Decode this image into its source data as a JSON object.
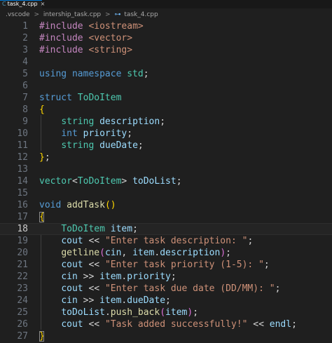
{
  "tab": {
    "icon": "C",
    "name": "task_4.cpp",
    "close": "×"
  },
  "breadcrumb": {
    "parts": [
      ".vscode",
      "intership_task.cpp",
      "task_4.cpp"
    ],
    "separator": ">",
    "symbol_icon": "⊶"
  },
  "editor": {
    "current_line": 18,
    "lines": [
      {
        "n": "1",
        "tokens": [
          [
            "pre",
            "#include "
          ],
          [
            "inc",
            "<iostream>"
          ]
        ]
      },
      {
        "n": "2",
        "tokens": [
          [
            "pre",
            "#include "
          ],
          [
            "inc",
            "<vector>"
          ]
        ]
      },
      {
        "n": "3",
        "tokens": [
          [
            "pre",
            "#include "
          ],
          [
            "inc",
            "<string>"
          ]
        ]
      },
      {
        "n": "4",
        "tokens": []
      },
      {
        "n": "5",
        "tokens": [
          [
            "kw",
            "using namespace "
          ],
          [
            "type",
            "std"
          ],
          [
            "text",
            ";"
          ]
        ]
      },
      {
        "n": "6",
        "tokens": []
      },
      {
        "n": "7",
        "tokens": [
          [
            "kw",
            "struct "
          ],
          [
            "type",
            "ToDoItem"
          ]
        ]
      },
      {
        "n": "8",
        "tokens": [
          [
            "br1",
            "{"
          ]
        ]
      },
      {
        "n": "9",
        "tokens": [
          [
            "text",
            "    "
          ],
          [
            "type",
            "string "
          ],
          [
            "var",
            "description"
          ],
          [
            "text",
            ";"
          ]
        ]
      },
      {
        "n": "10",
        "tokens": [
          [
            "text",
            "    "
          ],
          [
            "kw",
            "int "
          ],
          [
            "var",
            "priority"
          ],
          [
            "text",
            ";"
          ]
        ]
      },
      {
        "n": "11",
        "tokens": [
          [
            "text",
            "    "
          ],
          [
            "type",
            "string "
          ],
          [
            "var",
            "dueDate"
          ],
          [
            "text",
            ";"
          ]
        ]
      },
      {
        "n": "12",
        "tokens": [
          [
            "br1",
            "}"
          ],
          [
            "text",
            ";"
          ]
        ]
      },
      {
        "n": "13",
        "tokens": []
      },
      {
        "n": "14",
        "tokens": [
          [
            "type",
            "vector"
          ],
          [
            "text",
            "<"
          ],
          [
            "type",
            "ToDoItem"
          ],
          [
            "text",
            "> "
          ],
          [
            "var",
            "toDoList"
          ],
          [
            "text",
            ";"
          ]
        ]
      },
      {
        "n": "15",
        "tokens": []
      },
      {
        "n": "16",
        "tokens": [
          [
            "kw",
            "void "
          ],
          [
            "fn",
            "addTask"
          ],
          [
            "br1",
            "()"
          ]
        ]
      },
      {
        "n": "17",
        "tokens": [
          [
            "br1",
            "{"
          ]
        ]
      },
      {
        "n": "18",
        "tokens": [
          [
            "text",
            "    "
          ],
          [
            "type",
            "ToDoItem "
          ],
          [
            "var",
            "item"
          ],
          [
            "text",
            ";"
          ]
        ]
      },
      {
        "n": "19",
        "tokens": [
          [
            "text",
            "    "
          ],
          [
            "var",
            "cout "
          ],
          [
            "op",
            "<< "
          ],
          [
            "str",
            "\"Enter task description: \""
          ],
          [
            "text",
            ";"
          ]
        ]
      },
      {
        "n": "20",
        "tokens": [
          [
            "text",
            "    "
          ],
          [
            "fn",
            "getline"
          ],
          [
            "br2",
            "("
          ],
          [
            "var",
            "cin"
          ],
          [
            "text",
            ", "
          ],
          [
            "var",
            "item"
          ],
          [
            "text",
            "."
          ],
          [
            "var",
            "description"
          ],
          [
            "br2",
            ")"
          ],
          [
            "text",
            ";"
          ]
        ]
      },
      {
        "n": "21",
        "tokens": [
          [
            "text",
            "    "
          ],
          [
            "var",
            "cout "
          ],
          [
            "op",
            "<< "
          ],
          [
            "str",
            "\"Enter task priority (1-5): \""
          ],
          [
            "text",
            ";"
          ]
        ]
      },
      {
        "n": "22",
        "tokens": [
          [
            "text",
            "    "
          ],
          [
            "var",
            "cin "
          ],
          [
            "op",
            ">> "
          ],
          [
            "var",
            "item"
          ],
          [
            "text",
            "."
          ],
          [
            "var",
            "priority"
          ],
          [
            "text",
            ";"
          ]
        ]
      },
      {
        "n": "23",
        "tokens": [
          [
            "text",
            "    "
          ],
          [
            "var",
            "cout "
          ],
          [
            "op",
            "<< "
          ],
          [
            "str",
            "\"Enter task due date (DD/MM): \""
          ],
          [
            "text",
            ";"
          ]
        ]
      },
      {
        "n": "24",
        "tokens": [
          [
            "text",
            "    "
          ],
          [
            "var",
            "cin "
          ],
          [
            "op",
            ">> "
          ],
          [
            "var",
            "item"
          ],
          [
            "text",
            "."
          ],
          [
            "var",
            "dueDate"
          ],
          [
            "text",
            ";"
          ]
        ]
      },
      {
        "n": "25",
        "tokens": [
          [
            "text",
            "    "
          ],
          [
            "var",
            "toDoList"
          ],
          [
            "text",
            "."
          ],
          [
            "fn",
            "push_back"
          ],
          [
            "br2",
            "("
          ],
          [
            "var",
            "item"
          ],
          [
            "br2",
            ")"
          ],
          [
            "text",
            ";"
          ]
        ]
      },
      {
        "n": "26",
        "tokens": [
          [
            "text",
            "    "
          ],
          [
            "var",
            "cout "
          ],
          [
            "op",
            "<< "
          ],
          [
            "str",
            "\"Task added successfully!\" "
          ],
          [
            "op",
            "<< "
          ],
          [
            "var",
            "endl"
          ],
          [
            "text",
            ";"
          ]
        ]
      },
      {
        "n": "27",
        "tokens": [
          [
            "br1",
            "}"
          ]
        ]
      }
    ]
  },
  "colors": {
    "background": "#1f1f1f",
    "keyword": "#569cd6",
    "preprocessor": "#c586c0",
    "type": "#4ec9b0",
    "variable": "#9cdcfe",
    "function": "#dcdcaa",
    "string": "#ce9178"
  }
}
